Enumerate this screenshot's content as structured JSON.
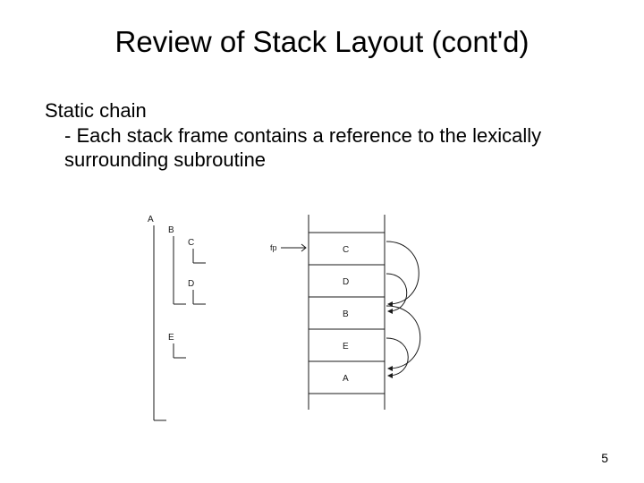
{
  "title": "Review of Stack Layout (cont'd)",
  "heading": "Static chain",
  "bullet": "- Each stack frame contains a reference to the lexically surrounding subroutine",
  "page_number": "5",
  "tree": {
    "A": "A",
    "B": "B",
    "C": "C",
    "D": "D",
    "E": "E"
  },
  "fp_label": "fp",
  "stack_frames": [
    "C",
    "D",
    "B",
    "E",
    "A"
  ]
}
